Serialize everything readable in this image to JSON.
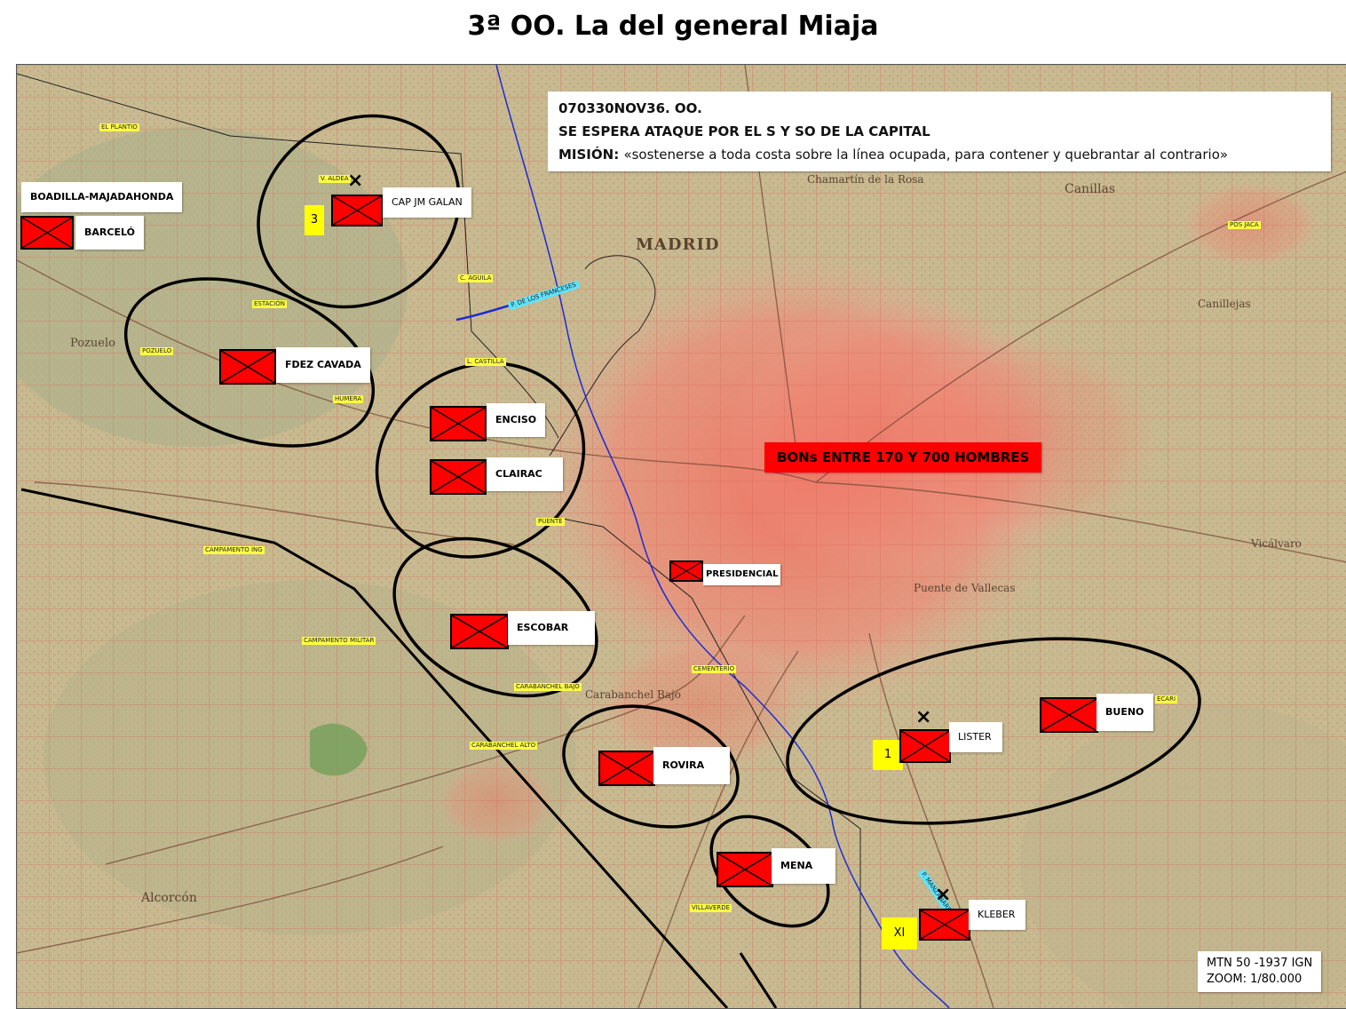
{
  "title": "3ª OO. La del general Miaja",
  "info": {
    "line1": "070330NOV36. OO.",
    "line2": "SE ESPERA ATAQUE POR EL S Y SO DE LA CAPITAL",
    "mission_label": "MISIÓN:",
    "mission_text": "«sostenerse a toda costa sobre la línea ocupada, para contener y quebrantar al contrario»"
  },
  "banner": "BONs ENTRE 170 Y 700 HOMBRES",
  "map_note": {
    "line1": "MTN 50 -1937 IGN",
    "line2": "ZOOM: 1/80.000"
  },
  "sector_label": "BOADILLA-MAJADAHONDA",
  "units": {
    "barcelo": "BARCELÓ",
    "galan": "CAP JM GALAN",
    "fdez_cavada": "FDEZ CAVADA",
    "enciso": "ENCISO",
    "clairac": "CLAIRAC",
    "escobar": "ESCOBAR",
    "presidencial": "PRESIDENCIAL",
    "rovira": "ROVIRA",
    "mena": "MENA",
    "lister": "LISTER",
    "bueno": "BUENO",
    "kleber": "KLEBER"
  },
  "brigade_numbers": {
    "galan": "3",
    "lister": "1",
    "kleber": "XI"
  },
  "toponyms": {
    "el_plantio": "EL PLANTIO",
    "aravaca": "V. ALDEA",
    "estacion": "ESTACIÓN",
    "pozuelo": "POZUELO",
    "humera": "HUMERA",
    "c_aguila": "C. AGUILA",
    "casa_campo": "L. CASTILLA",
    "campamento_ing": "CAMPAMENTO ING",
    "campamento_militar": "CAMPAMENTO MILITAR",
    "carabanchel_bajo": "CARABANCHEL BAJO",
    "carabanchel_alto": "CARABANCHEL ALTO",
    "villaverde": "VILLAVERDE",
    "pos_jaca": "POS JACA",
    "ecari": "ECARI",
    "puente": "PUENTE",
    "cementerio": "CEMENTERIO",
    "rios_rosas": "LAS ROSAS"
  },
  "cyan_tags": {
    "puente_franceses": "P. DE LOS FRANCESES",
    "manzanares": "P. MANZANARES"
  },
  "map_texts": {
    "madrid": "MADRID",
    "chamartin": "Chamartín de la Rosa",
    "canillas": "Canillas",
    "canillejas": "Canillejas",
    "pozuelo": "Pozuelo",
    "alcorcon": "Alcorcón",
    "vallecas": "Puente de Vallecas",
    "vicalvaro": "Vicálvaro",
    "carabanchel": "Carabanchel Bajo"
  },
  "colors": {
    "unit_fill": "#ff0000",
    "number_bg": "#ffff00",
    "river": "#1a2bd6",
    "ellipse": "#000000"
  }
}
